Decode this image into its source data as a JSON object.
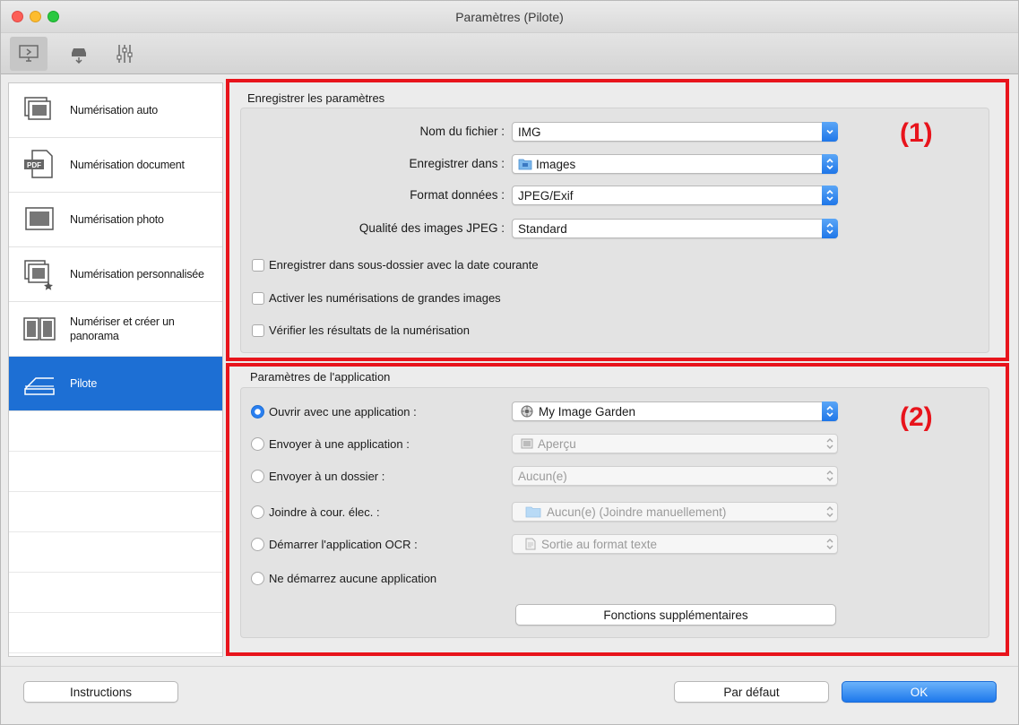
{
  "window": {
    "title": "Paramètres (Pilote)"
  },
  "toolbar": {
    "tabs": [
      {
        "icon": "scan-from-computer-icon",
        "active": true
      },
      {
        "icon": "scan-from-operation-panel-icon",
        "active": false
      },
      {
        "icon": "general-settings-icon",
        "active": false
      }
    ]
  },
  "sidebar": {
    "items": [
      {
        "label": "Numérisation auto",
        "icon": "auto-scan-icon"
      },
      {
        "label": "Numérisation document",
        "icon": "pdf-document-icon"
      },
      {
        "label": "Numérisation photo",
        "icon": "photo-scan-icon"
      },
      {
        "label": "Numérisation personnalisée",
        "icon": "custom-scan-icon"
      },
      {
        "label": "Numériser et créer un panorama",
        "icon": "panorama-icon"
      },
      {
        "label": "Pilote",
        "icon": "driver-icon",
        "selected": true
      }
    ]
  },
  "save_settings": {
    "title": "Enregistrer les paramètres",
    "file_name_label": "Nom du fichier :",
    "file_name_value": "IMG",
    "save_in_label": "Enregistrer dans :",
    "save_in_value": "Images",
    "data_format_label": "Format données :",
    "data_format_value": "JPEG/Exif",
    "jpeg_quality_label": "Qualité des images JPEG :",
    "jpeg_quality_value": "Standard",
    "checkbox_subfolder": "Enregistrer dans sous-dossier avec la date courante",
    "checkbox_large": "Activer les numérisations de grandes images",
    "checkbox_check": "Vérifier les résultats de la numérisation",
    "marker": "(1)"
  },
  "app_settings": {
    "title": "Paramètres de l'application",
    "open_with_label": "Ouvrir avec une application :",
    "open_with_value": "My Image Garden",
    "send_app_label": "Envoyer à une application :",
    "send_app_value": "Aperçu",
    "send_folder_label": "Envoyer à un dossier :",
    "send_folder_value": "Aucun(e)",
    "attach_label": "Joindre à cour. élec. :",
    "attach_value": "Aucun(e) (Joindre manuellement)",
    "ocr_label": "Démarrer l'application OCR :",
    "ocr_value": "Sortie au format texte",
    "none_label": "Ne démarrez aucune application",
    "more_functions": "Fonctions supplémentaires",
    "marker": "(2)"
  },
  "footer": {
    "instructions": "Instructions",
    "defaults": "Par défaut",
    "ok": "OK"
  },
  "colors": {
    "accent": "#1d6fd4",
    "highlight_frame": "#e8141c"
  }
}
